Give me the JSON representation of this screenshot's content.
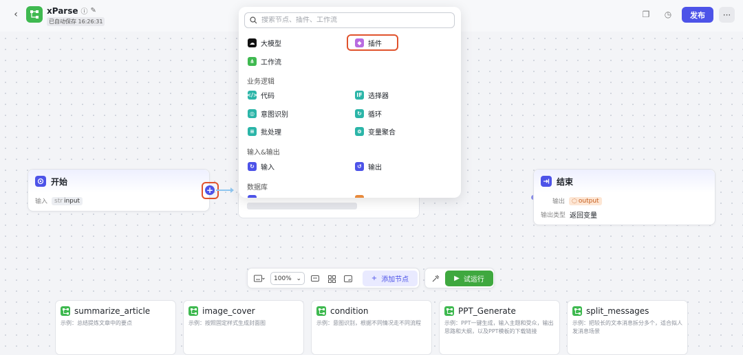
{
  "header": {
    "app_name": "xParse",
    "autosave": "已自动保存 16:26:31",
    "publish_label": "发布"
  },
  "start_node": {
    "title": "开始",
    "input_label": "输入",
    "input_type": "str",
    "input_name": "input"
  },
  "end_node": {
    "title": "结束",
    "output_label": "输出",
    "output_name": "output",
    "output_type_label": "输出类型",
    "output_type_value": "返回变量"
  },
  "node_picker": {
    "search_placeholder": "搜索节点、插件、工作流",
    "top_items": [
      {
        "label": "大模型",
        "icon": "llm-icon",
        "color": "#111111"
      },
      {
        "label": "插件",
        "icon": "plugin-icon",
        "color": "#b86be0"
      },
      {
        "label": "工作流",
        "icon": "workflow-icon",
        "color": "#3fb950"
      }
    ],
    "sections": [
      {
        "title": "业务逻辑",
        "items": [
          {
            "label": "代码",
            "icon": "code-icon",
            "color": "#2bb5a8"
          },
          {
            "label": "选择器",
            "icon": "selector-icon",
            "color": "#2bb5a8"
          },
          {
            "label": "意图识别",
            "icon": "intent-icon",
            "color": "#2bb5a8"
          },
          {
            "label": "循环",
            "icon": "loop-icon",
            "color": "#2bb5a8"
          },
          {
            "label": "批处理",
            "icon": "batch-icon",
            "color": "#2bb5a8"
          },
          {
            "label": "变量聚合",
            "icon": "aggregate-icon",
            "color": "#2bb5a8"
          }
        ]
      },
      {
        "title": "输入&输出",
        "items": [
          {
            "label": "输入",
            "icon": "input-icon",
            "color": "#4d53e8"
          },
          {
            "label": "输出",
            "icon": "output-icon",
            "color": "#4d53e8"
          }
        ]
      },
      {
        "title": "数据库",
        "items": []
      }
    ]
  },
  "toolbar": {
    "zoom": "100%",
    "add_node_label": "添加节点",
    "run_label": "试运行"
  },
  "templates": [
    {
      "name": "summarize_article",
      "desc": "示例：总结提炼文章中的要点"
    },
    {
      "name": "image_cover",
      "desc": "示例：按照固定样式生成封面图"
    },
    {
      "name": "condition",
      "desc": "示例：意图识别，根据不同情况走不同流程"
    },
    {
      "name": "PPT_Generate",
      "desc": "示例：PPT一键生成，输入主题和受众，输出思路和大纲，以及PPT模板的下载链接"
    },
    {
      "name": "split_messages",
      "desc": "示例：把较长的文本消息拆分多个，适合拟人发消息场景"
    }
  ],
  "colors": {
    "accent": "#4d53e8",
    "run": "#3fa83f",
    "highlight": "#e0522c"
  }
}
